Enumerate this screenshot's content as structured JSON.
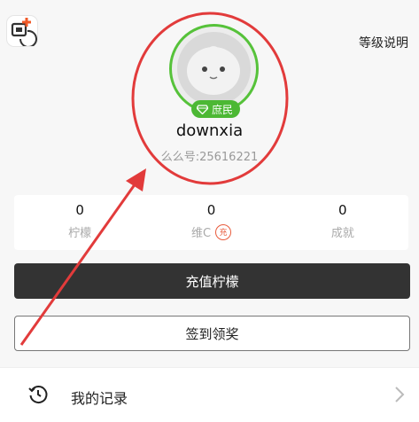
{
  "header": {
    "level_link": "等级说明"
  },
  "profile": {
    "badge": "庶民",
    "username": "downxia",
    "uid": "么么号:25616221"
  },
  "stats": [
    {
      "value": "0",
      "label": "柠檬"
    },
    {
      "value": "0",
      "label": "维C",
      "tag": "充"
    },
    {
      "value": "0",
      "label": "成就"
    }
  ],
  "buttons": {
    "recharge": "充值柠檬",
    "checkin": "签到领奖"
  },
  "menu": {
    "records": "我的记录"
  },
  "colors": {
    "accent_green": "#56c23a",
    "annotation_red": "#e23b3b",
    "dark_button": "#333333"
  }
}
